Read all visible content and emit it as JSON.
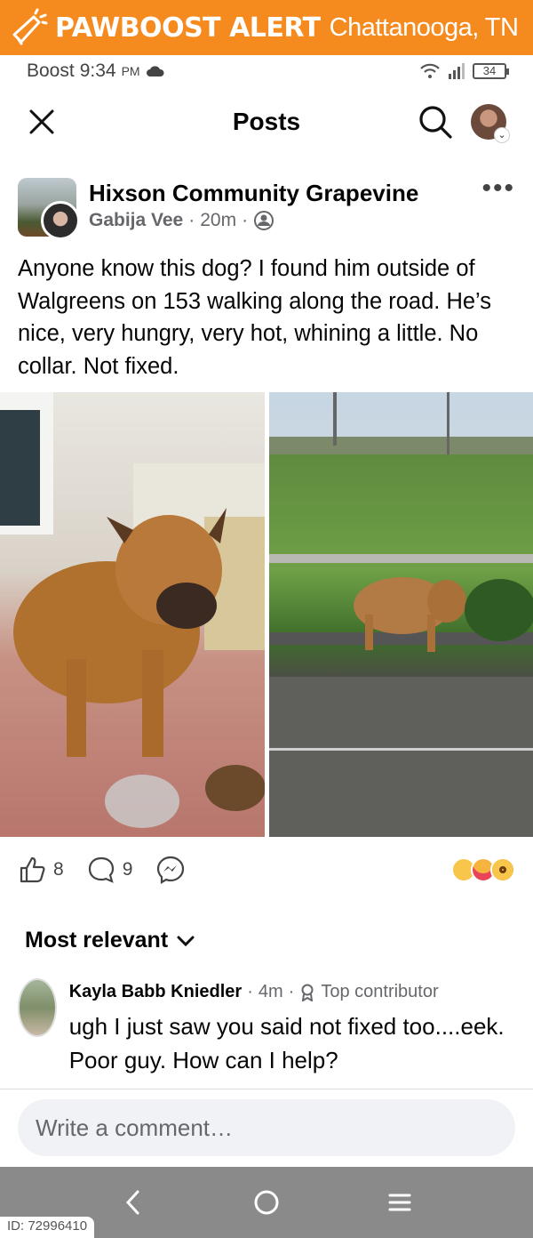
{
  "alert": {
    "title": "PAWBOOST ALERT",
    "location": "Chattanooga, TN"
  },
  "status_bar": {
    "carrier": "Boost",
    "time": "9:34",
    "ampm": "PM",
    "battery": "34"
  },
  "header": {
    "title": "Posts"
  },
  "post": {
    "group": "Hixson Community Grapevine",
    "author": "Gabija Vee",
    "time": "20m",
    "text": "Anyone know this dog? I found him outside of Walgreens on 153 walking along the road. He’s nice, very hungry, very hot, whining a little. No collar. Not fixed.",
    "likes": "8",
    "comments": "9"
  },
  "sort": {
    "label": "Most relevant"
  },
  "comment": {
    "name": "Kayla Babb Kniedler",
    "time": "4m",
    "badge": "Top contributor",
    "text": "ugh I just saw you said not fixed too....eek. Poor guy. How can I help?"
  },
  "composer": {
    "placeholder": "Write a comment…"
  },
  "footer": {
    "id": "ID: 72996410"
  },
  "colors": {
    "banner": "#f58a1f",
    "navbar": "#8a8a8a"
  }
}
